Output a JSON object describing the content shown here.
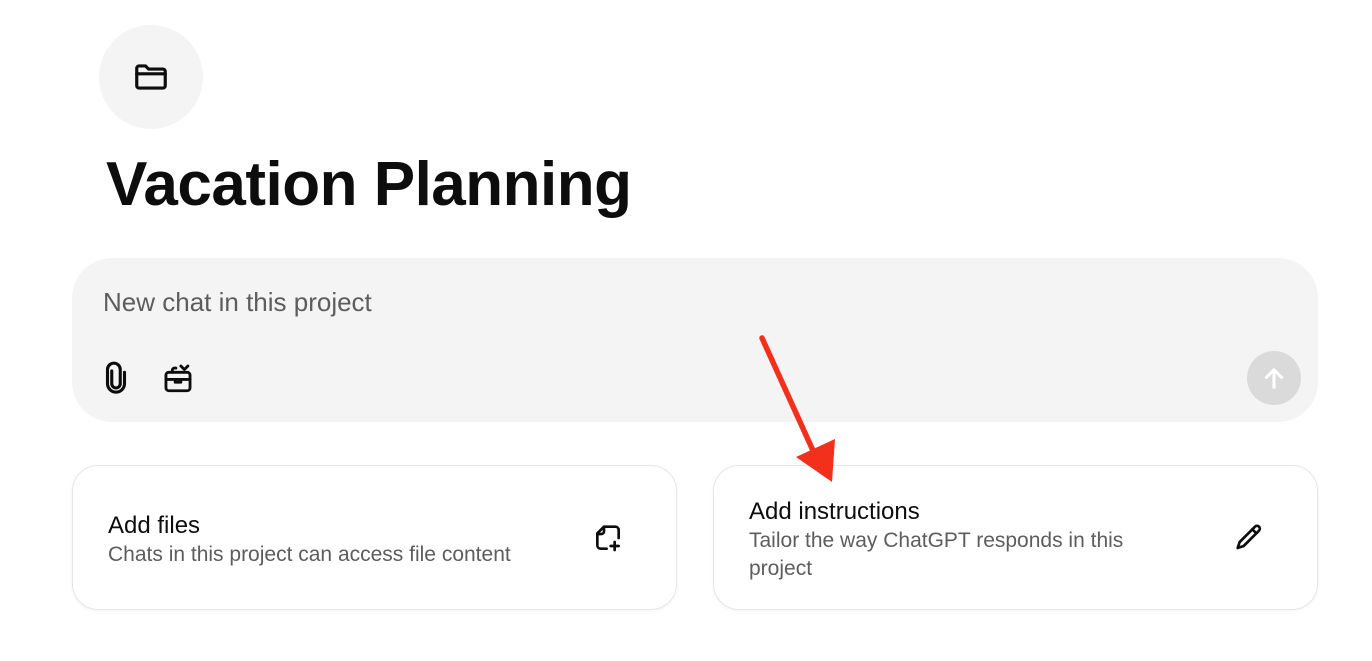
{
  "project": {
    "title": "Vacation Planning",
    "icon": "folder-icon"
  },
  "composer": {
    "placeholder": "New chat in this project",
    "value": "",
    "attach_icon": "paperclip-icon",
    "tools_icon": "toolbox-icon",
    "send_icon": "arrow-up-icon"
  },
  "cards": {
    "files": {
      "title": "Add files",
      "description": "Chats in this project can access file content",
      "icon": "file-add-icon"
    },
    "instructions": {
      "title": "Add instructions",
      "description": "Tailor the way ChatGPT responds in this project",
      "icon": "pencil-icon"
    }
  },
  "annotation": {
    "arrow_color": "#f2301c",
    "points_to": "instructions-card"
  },
  "colors": {
    "composer_bg": "#f4f4f4",
    "send_button_disabled": "#dadada",
    "text_primary": "#0d0d0d",
    "text_secondary": "#5d5d5d"
  }
}
